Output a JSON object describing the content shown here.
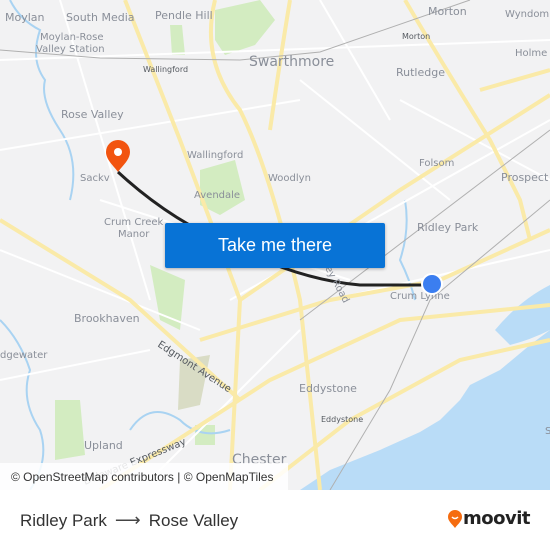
{
  "map": {
    "labels": {
      "moylan": "Moylan",
      "south_media": "South Media",
      "pendle_hill": "Pendle Hill",
      "moylan_rose_1": "Moylan-Rose",
      "moylan_rose_2": "Valley Station",
      "wallingford_station": "Wallingford",
      "swarthmore": "Swarthmore",
      "morton_area": "Morton",
      "morton_station": "Morton",
      "wyndmoor": "Wyndom",
      "holmes": "Holme",
      "rutledge": "Rutledge",
      "rose_valley": "Rose Valley",
      "wallingford": "Wallingford",
      "folsom": "Folsom",
      "prospect": "Prospect",
      "sackville": "Sackv",
      "avendale": "Avendale",
      "woodlyn": "Woodlyn",
      "crum_creek_1": "Crum Creek",
      "crum_creek_2": "Manor",
      "ridley_park": "Ridley Park",
      "crum_lynne": "Crum Lynne",
      "road_label": "ey Road",
      "brookhaven": "Brookhaven",
      "edgewater": "dgewater",
      "edgmont": "Edgmont Avenue",
      "eddystone_area": "Eddystone",
      "eddystone_station": "Eddystone",
      "upland": "Upland",
      "expressway": "Delaware Expressway",
      "chester": "Chester",
      "s_edge": "S"
    },
    "origin": "Ridley Park",
    "destination": "Rose Valley",
    "cta_label": "Take me there",
    "attribution": "© OpenStreetMap contributors | © OpenMapTiles"
  },
  "footer": {
    "from": "Ridley Park",
    "arrow": "⟶",
    "to": "Rose Valley",
    "brand": "moovit"
  },
  "colors": {
    "cta": "#0873d6",
    "origin_dot": "#3b7ef0",
    "destination_pin": "#f2540f",
    "route_line": "#222222",
    "water": "#b9dcf7",
    "park": "#d3ecc1",
    "major_road": "#faeaa8",
    "brand_orange": "#f56c10"
  }
}
